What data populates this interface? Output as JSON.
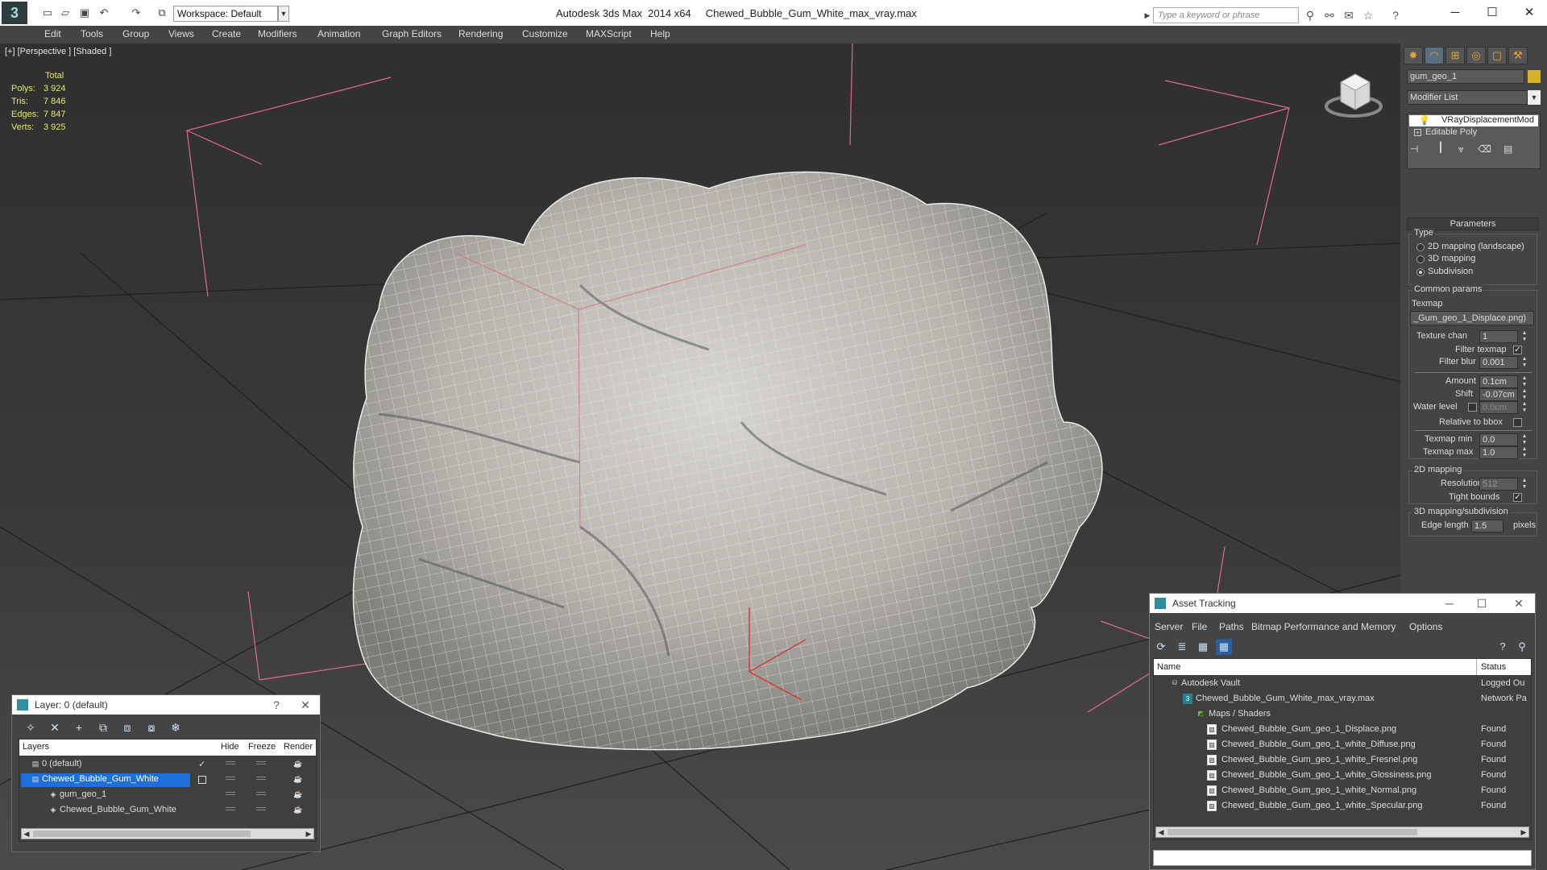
{
  "app": {
    "title": "Autodesk 3ds Max  2014 x64     Chewed_Bubble_Gum_White_max_vray.max",
    "workspace": "Workspace: Default",
    "search_placeholder": "Type a keyword or phrase"
  },
  "menu": [
    "Edit",
    "Tools",
    "Group",
    "Views",
    "Create",
    "Modifiers",
    "Animation",
    "Graph Editors",
    "Rendering",
    "Customize",
    "MAXScript",
    "Help"
  ],
  "viewport": {
    "label": "[+] [Perspective ] [Shaded ]",
    "stats": {
      "header": "Total",
      "rows": [
        {
          "label": "Polys:",
          "value": "3 924"
        },
        {
          "label": "Tris:",
          "value": "7 846"
        },
        {
          "label": "Edges:",
          "value": "7 847"
        },
        {
          "label": "Verts:",
          "value": "3 925"
        }
      ]
    }
  },
  "command_panel": {
    "object_name": "gum_geo_1",
    "object_color": "#d4b22a",
    "modifier_list": "Modifier List",
    "stack": [
      "VRayDisplacementMod",
      "Editable Poly"
    ],
    "parameters_title": "Parameters",
    "type_label": "Type",
    "type_options": [
      "2D mapping (landscape)",
      "3D mapping",
      "Subdivision"
    ],
    "type_selected": 2,
    "common_params": "Common params",
    "texmap_label": "Texmap",
    "texmap_value": "_Gum_geo_1_Displace.png)",
    "texture_chan_label": "Texture chan",
    "texture_chan_value": "1",
    "filter_texmap_label": "Filter texmap",
    "filter_texmap_checked": "✓",
    "filter_blur_label": "Filter blur",
    "filter_blur_value": "0.001",
    "amount_label": "Amount",
    "amount_value": "0.1cm",
    "shift_label": "Shift",
    "shift_value": "-0.07cm",
    "water_level_label": "Water level",
    "water_level_value": "0.0cm",
    "relative_bbox_label": "Relative to bbox",
    "texmap_min_label": "Texmap min",
    "texmap_min_value": "0.0",
    "texmap_max_label": "Texmap max",
    "texmap_max_value": "1.0",
    "mapping_2d_label": "2D mapping",
    "resolution_label": "Resolution",
    "resolution_value": "512",
    "tight_bounds_label": "Tight bounds",
    "tight_bounds_checked": "✓",
    "mapping_3d_label": "3D mapping/subdivision",
    "edge_length_label": "Edge length",
    "edge_length_value": "1.5",
    "edge_length_unit": "pixels"
  },
  "layer_dialog": {
    "title": "Layer: 0 (default)",
    "help": "?",
    "columns": [
      "Layers",
      "Hide",
      "Freeze",
      "Render"
    ],
    "rows": [
      {
        "name": "0 (default)",
        "active": "✓"
      },
      {
        "name": "Chewed_Bubble_Gum_White",
        "selected": true
      },
      {
        "name": "gum_geo_1"
      },
      {
        "name": "Chewed_Bubble_Gum_White"
      }
    ]
  },
  "asset_tracking": {
    "title": "Asset Tracking",
    "menu": [
      "Server",
      "File",
      "Paths",
      "Bitmap Performance and Memory",
      "Options"
    ],
    "columns": [
      "Name",
      "Status"
    ],
    "rows": [
      {
        "name": "Autodesk Vault",
        "status": "Logged Ou",
        "icon": "vault-icon"
      },
      {
        "name": "Chewed_Bubble_Gum_White_max_vray.max",
        "status": "Network Pa",
        "icon": "max-file-icon"
      },
      {
        "name": "Maps / Shaders",
        "status": "",
        "icon": "folder-icon"
      },
      {
        "name": "Chewed_Bubble_Gum_geo_1_Displace.png",
        "status": "Found",
        "icon": "image-file-icon"
      },
      {
        "name": "Chewed_Bubble_Gum_geo_1_white_Diffuse.png",
        "status": "Found",
        "icon": "image-file-icon"
      },
      {
        "name": "Chewed_Bubble_Gum_geo_1_white_Fresnel.png",
        "status": "Found",
        "icon": "image-file-icon"
      },
      {
        "name": "Chewed_Bubble_Gum_geo_1_white_Glossiness.png",
        "status": "Found",
        "icon": "image-file-icon"
      },
      {
        "name": "Chewed_Bubble_Gum_geo_1_white_Normal.png",
        "status": "Found",
        "icon": "image-file-icon"
      },
      {
        "name": "Chewed_Bubble_Gum_geo_1_white_Specular.png",
        "status": "Found",
        "icon": "image-file-icon"
      }
    ]
  }
}
